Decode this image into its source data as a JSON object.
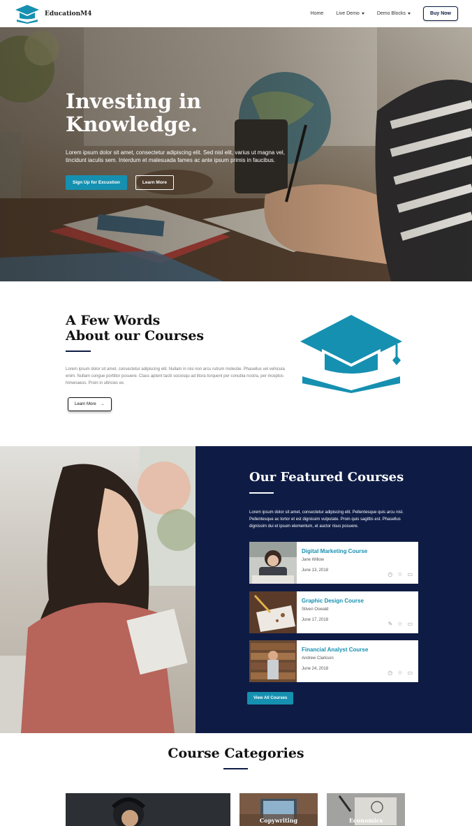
{
  "nav": {
    "brand": "EducationM4",
    "links": [
      "Home",
      "Live Demo",
      "Demo Blocks"
    ],
    "buy": "Buy Now"
  },
  "hero": {
    "title": "Investing in Knowledge.",
    "text": "Lorem ipsum dolor sit amet, consectetur adipiscing elit. Sed nisl elit, varius ut magna vel, tincidunt iaculis sem. Interdum et malesuada fames ac ante ipsum primis in faucibus.",
    "primary_btn": "Sign Up for Excustion",
    "secondary_btn": "Learn More"
  },
  "about": {
    "title_line1": "A Few Words",
    "title_line2": "About our Courses",
    "text": "Lorem ipsum dolor sit amet, consectetur adipiscing elit. Nullam in nisi non arcu rutrum molestie. Phasellus vel vehicula enim. Nullam congue porttitor posuere. Class aptent taciti sociosqu ad litora torquent per conubia nostra, per inceptos himenaeos. Proin in ultricies ex.",
    "button": "Learn More"
  },
  "featured": {
    "title": "Our Featured Courses",
    "text": "Lorem ipsum dolor sit amet, consectetur adipiscing elit. Pellentesque quis arcu nisl. Pellentesque ac tortor et est dignissim vulputate. Proin quis sagittis est. Phasellus dignissim dui et ipsum elementum, et auctor risus posuere.",
    "courses": [
      {
        "title": "Digital Marketing Course",
        "author": "Jane Willow",
        "date": "June 13, 2018",
        "icons": [
          "clock-icon",
          "star-icon",
          "monitor-icon"
        ]
      },
      {
        "title": "Graphic Design Course",
        "author": "Stiven Oswald",
        "date": "June 17, 2018",
        "icons": [
          "pencil-icon",
          "star-icon",
          "monitor-icon"
        ]
      },
      {
        "title": "Financial Analyst Course",
        "author": "Andrew Clarkson",
        "date": "June 24, 2018",
        "icons": [
          "clock-icon",
          "star-icon",
          "monitor-icon"
        ]
      }
    ],
    "view_all": "View All Courses"
  },
  "categories": {
    "title": "Course Categories",
    "items": [
      "",
      "Copywriting",
      "Economics"
    ]
  },
  "colors": {
    "accent": "#1690b0",
    "navy": "#0e1c45"
  }
}
